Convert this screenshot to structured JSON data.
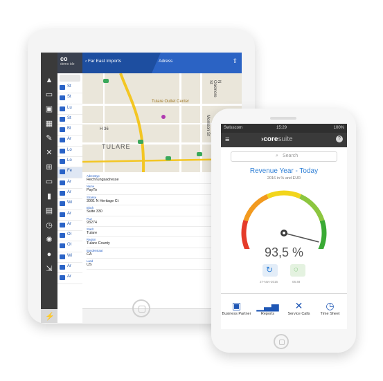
{
  "tablet": {
    "list_header": {
      "title": "co",
      "subtitle": "demo ide"
    },
    "list_rows": [
      "St",
      "St",
      "Lu",
      "St",
      "Bl",
      "Ar",
      "Lo",
      "Lo",
      "Fe",
      "Ar",
      "Ar",
      "Wi",
      "Ar",
      "Ar",
      "Ol",
      "Ol",
      "Wi",
      "Ar",
      "Ar"
    ],
    "rail_icons": [
      "warning-icon",
      "chat-icon",
      "contact-icon",
      "calendar-icon",
      "edit-icon",
      "tools-icon",
      "cart-icon",
      "monitor-icon",
      "bookmark-icon",
      "document-icon",
      "clock-icon",
      "settings-icon",
      "people-icon",
      "logout-icon"
    ],
    "nav": {
      "back_label": "Far East Imports",
      "title": "Adress"
    },
    "map": {
      "town_label": "TULARE",
      "poi_label": "Tulare Outlet Center",
      "street_labels": [
        "N Oakmore St",
        "Morrison St"
      ],
      "highway_label": "H 36"
    },
    "fields": [
      {
        "key": "Adresstyp",
        "value": "Rechnungsadresse"
      },
      {
        "key": "Name",
        "value": "PayTo"
      },
      {
        "key": "Strasse",
        "value": "3001 N Heritage Ct"
      },
      {
        "key": "Block",
        "value": "Suite 330"
      },
      {
        "key": "PLZ",
        "value": "93274"
      },
      {
        "key": "Stadt",
        "value": "Tulare"
      },
      {
        "key": "Region",
        "value": "Tulare County"
      },
      {
        "key": "Bundesstaat",
        "value": "CA"
      },
      {
        "key": "Land",
        "value": "US"
      }
    ]
  },
  "phone": {
    "status": {
      "carrier": "Swisscom",
      "time": "15:29",
      "battery": "100%"
    },
    "brand_main": "core",
    "brand_suffix": "suite",
    "search_placeholder": "Search",
    "title": "Revenue Year - Today",
    "subtitle": "2016 in % and EUR",
    "gauge": {
      "value": 93.5,
      "display": "93,5 %",
      "colors": [
        "#e53b2a",
        "#f29a1f",
        "#f2d51c",
        "#8cc63f",
        "#3aaa35"
      ]
    },
    "actions": {
      "left_date": "27-Nov-2016",
      "right_date": "06:48"
    },
    "tabs": [
      {
        "label": "Business Partner",
        "icon": "business-partner-icon"
      },
      {
        "label": "Reports",
        "icon": "reports-icon"
      },
      {
        "label": "Service Calls",
        "icon": "service-calls-icon"
      },
      {
        "label": "Time Sheet",
        "icon": "time-sheet-icon"
      }
    ]
  }
}
